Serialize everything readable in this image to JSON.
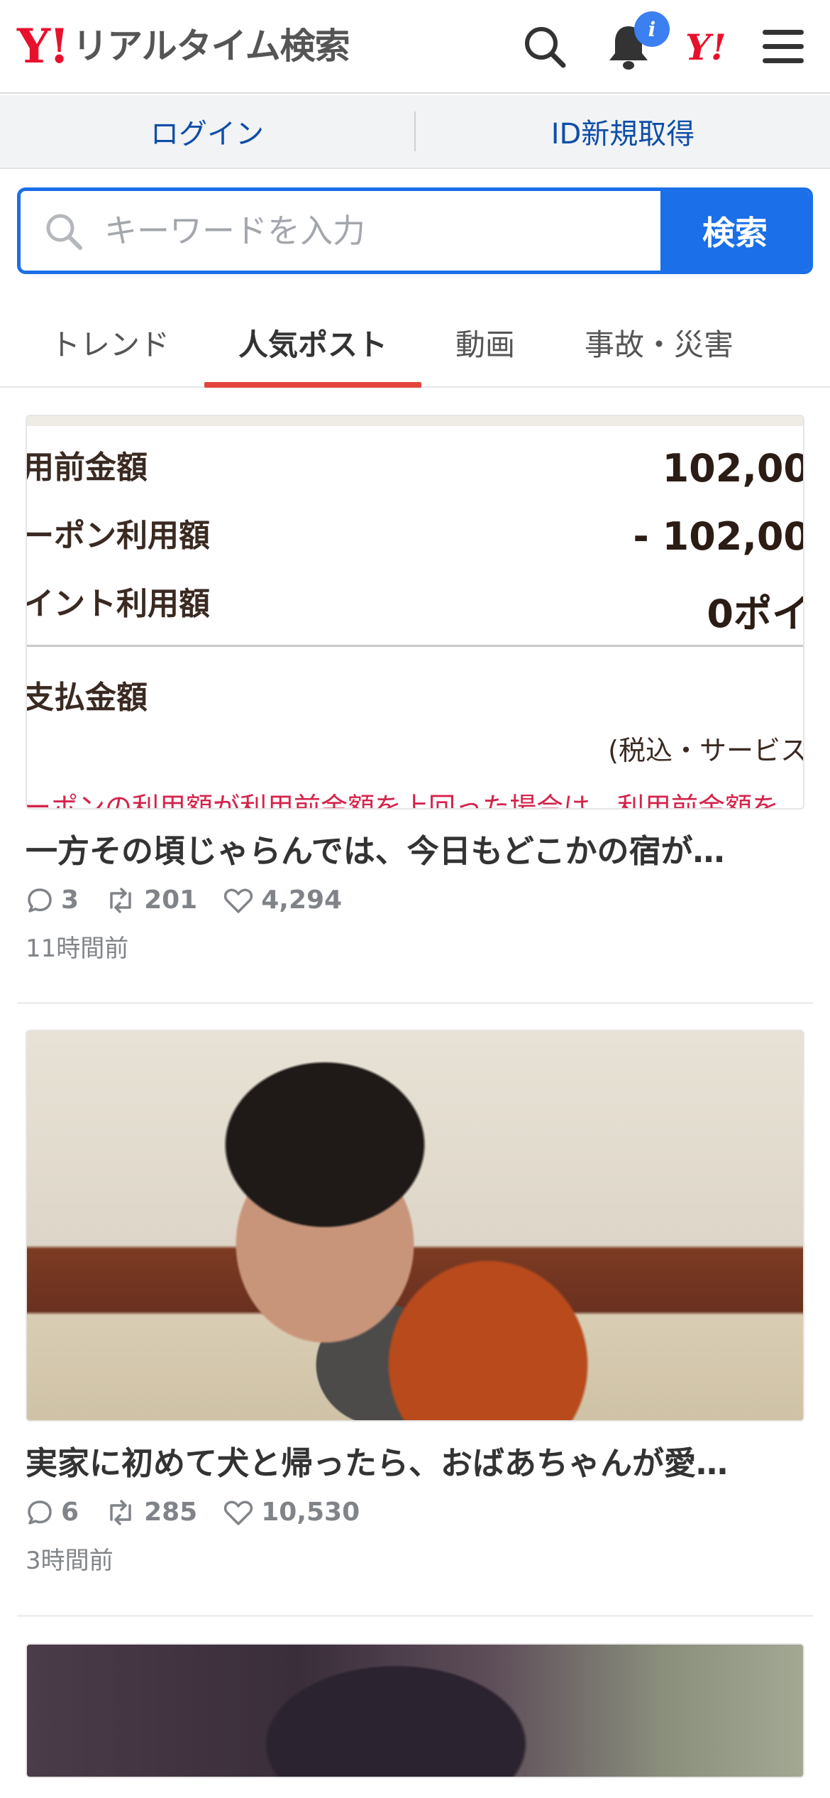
{
  "header": {
    "logo_mark": "Y!",
    "logo_text": "リアルタイム検索",
    "notification_badge": "i",
    "yahoo_mini": "Y!"
  },
  "account": {
    "login_label": "ログイン",
    "register_label": "ID新規取得"
  },
  "search": {
    "placeholder": "キーワードを入力",
    "button_label": "検索"
  },
  "tabs": [
    {
      "label": "トレンド",
      "active": false
    },
    {
      "label": "人気ポスト",
      "active": true
    },
    {
      "label": "動画",
      "active": false
    },
    {
      "label": "事故・災害",
      "active": false
    }
  ],
  "colors": {
    "accent_blue": "#1b6fe8",
    "brand_red": "#e8112d",
    "active_tab_underline": "#e4443c",
    "link_blue": "#0e4ea8"
  },
  "posts": [
    {
      "image": {
        "rows": [
          {
            "label": "用前金額",
            "value": "102,00"
          },
          {
            "label": "ーポン利用額",
            "value": "- 102,00"
          },
          {
            "label": "イント利用額",
            "value": "0ポイ"
          }
        ],
        "total_label": "支払金額",
        "note": "(税込・サービス",
        "red_text": "ーポンの利用額が利用前金額を上回った場合は、利用前金額を"
      },
      "title": "一方その頃じゃらんでは、今日もどこかの宿が…",
      "replies": "3",
      "reposts": "201",
      "likes": "4,294",
      "time": "11時間前"
    },
    {
      "image": {
        "description_icon": "photo"
      },
      "title": "実家に初めて犬と帰ったら、おばあちゃんが愛…",
      "replies": "6",
      "reposts": "285",
      "likes": "10,530",
      "time": "3時間前"
    }
  ]
}
